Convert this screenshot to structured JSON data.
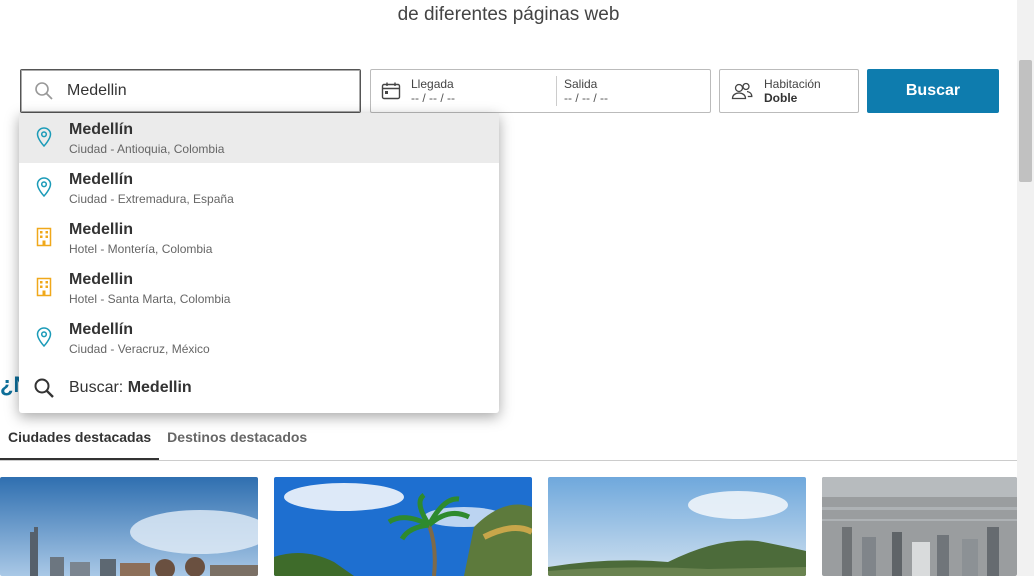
{
  "header": {
    "subtitle": "de diferentes páginas web"
  },
  "search": {
    "value": "Medellin",
    "icon": "search-icon"
  },
  "dates": {
    "arrival_label": "Llegada",
    "arrival_value": "-- / -- / --",
    "departure_label": "Salida",
    "departure_value": "-- / -- / --"
  },
  "room": {
    "label": "Habitación",
    "value": "Doble"
  },
  "search_button": {
    "label": "Buscar",
    "color": "#0e7cae"
  },
  "suggestions": [
    {
      "name": "Medellín",
      "detail": "Ciudad - Antioquia, Colombia",
      "icon": "location-pin-icon"
    },
    {
      "name": "Medellín",
      "detail": "Ciudad - Extremadura, España",
      "icon": "location-pin-icon"
    },
    {
      "name": "Medellin",
      "detail": "Hotel - Montería, Colombia",
      "icon": "hotel-building-icon"
    },
    {
      "name": "Medellin",
      "detail": "Hotel - Santa Marta, Colombia",
      "icon": "hotel-building-icon"
    },
    {
      "name": "Medellín",
      "detail": "Ciudad - Veracruz, México",
      "icon": "location-pin-icon"
    }
  ],
  "search_suggestion": {
    "prefix": "Buscar: ",
    "query": "Medellin"
  },
  "section": {
    "title_visible": "¿N"
  },
  "tabs": [
    {
      "label": "Ciudades destacadas",
      "active": true
    },
    {
      "label": "Destinos destacados",
      "active": false
    }
  ],
  "colors": {
    "pin": "#1b9bb8",
    "hotel": "#f0a81a",
    "accent": "#0e7cae"
  }
}
